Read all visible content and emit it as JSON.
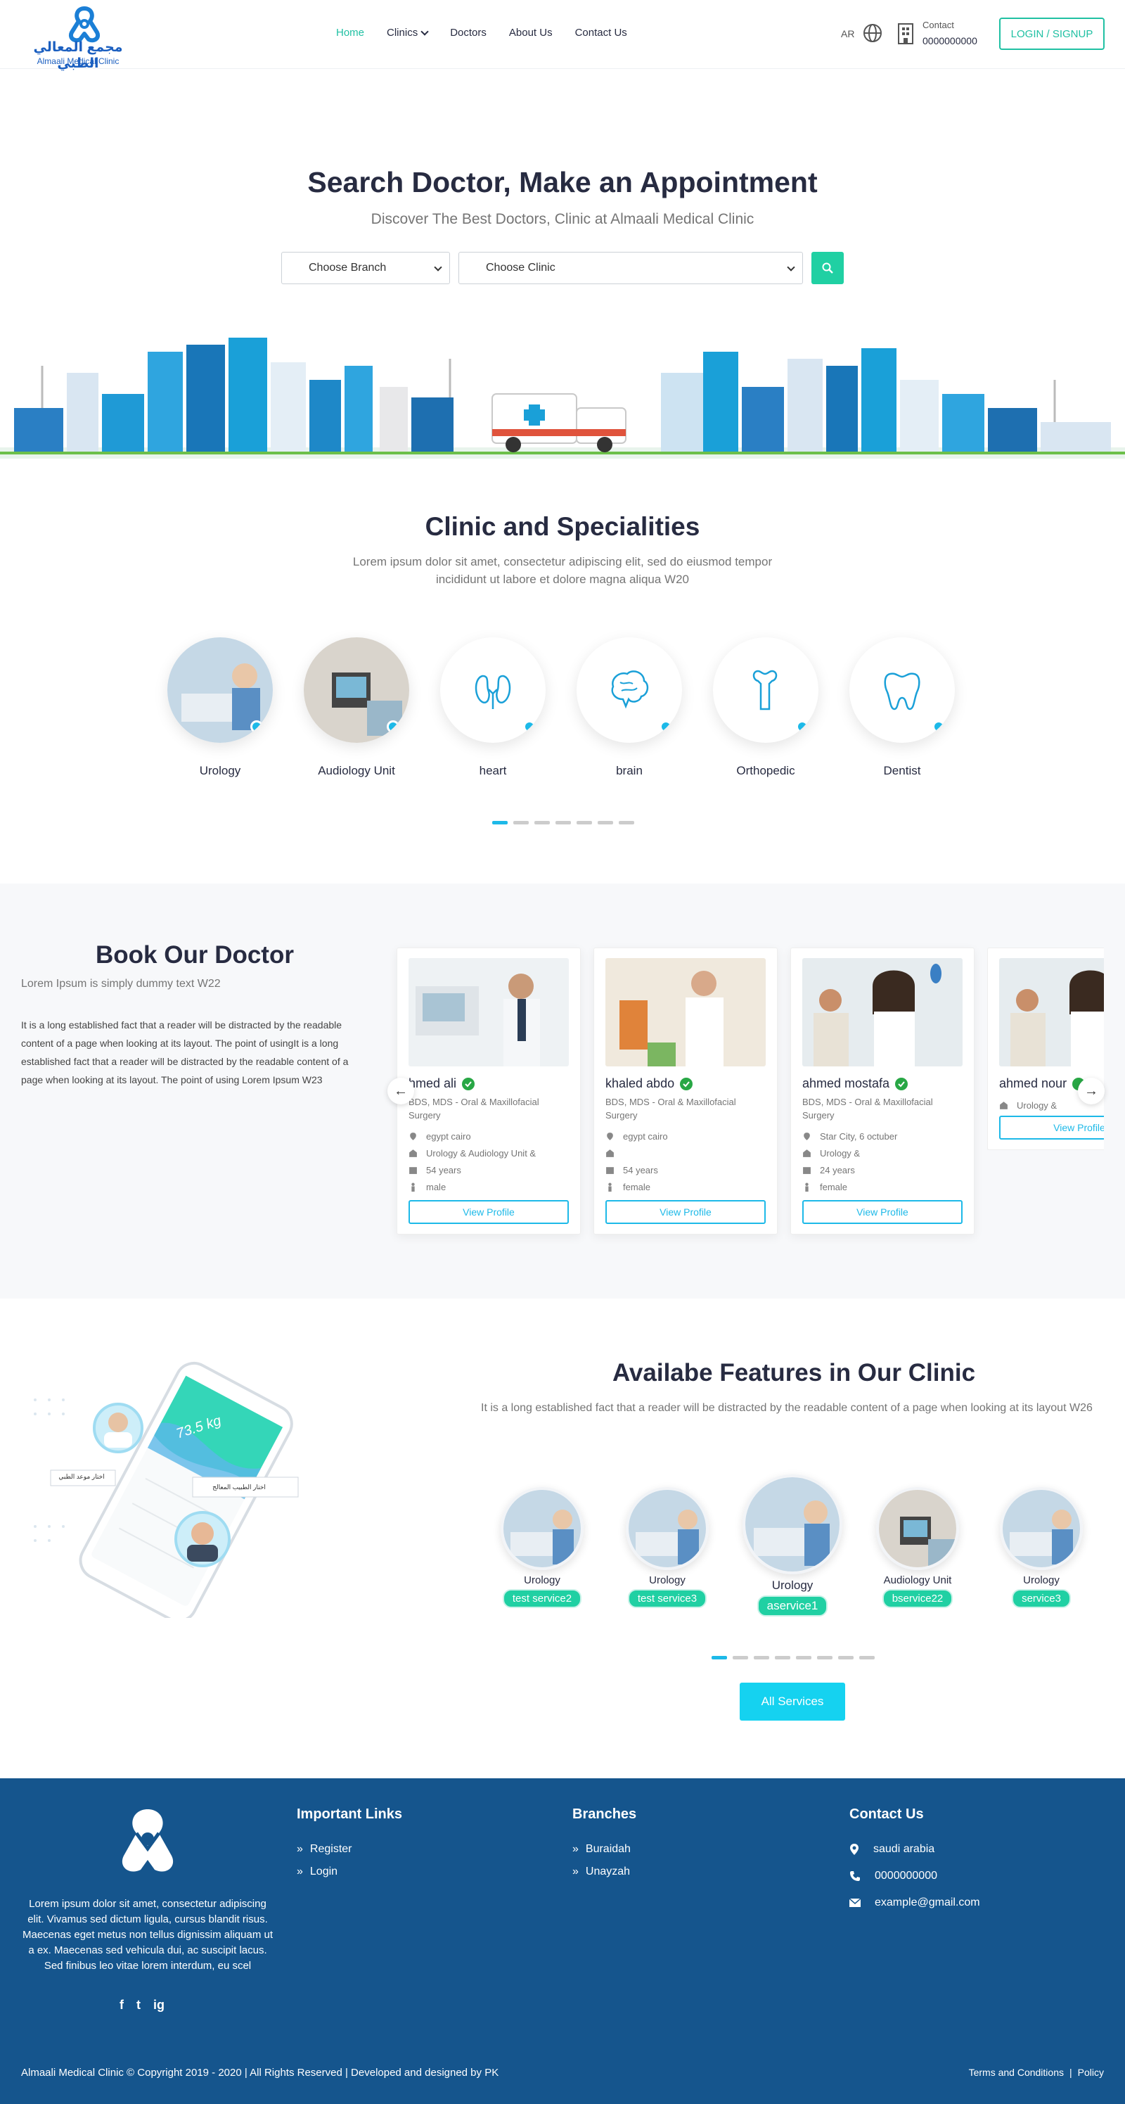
{
  "brand": {
    "name_ar": "مجمع المعالي الطبي",
    "name_en": "Almaali Medical Clinic"
  },
  "nav": {
    "items": [
      "Home",
      "Clinics",
      "Doctors",
      "About Us",
      "Contact Us"
    ],
    "lang": "AR",
    "contact_label": "Contact",
    "contact_number": "0000000000",
    "login_label": "LOGIN / SIGNUP"
  },
  "hero": {
    "title": "Search Doctor, Make an Appointment",
    "subtitle": "Discover The Best Doctors, Clinic at Almaali Medical Clinic",
    "branch_select": "Choose Branch",
    "clinic_select": "Choose Clinic"
  },
  "specialities": {
    "title": "Clinic and Specialities",
    "subtitle": "Lorem ipsum dolor sit amet, consectetur adipiscing elit, sed do eiusmod tempor incididunt ut labore et dolore magna aliqua W20",
    "items": [
      "Urology",
      "Audiology Unit",
      "heart",
      "brain",
      "Orthopedic",
      "Dentist"
    ]
  },
  "book": {
    "title": "Book Our Doctor",
    "subtitle": "Lorem Ipsum is simply dummy text W22",
    "text": "It is a long established fact that a reader will be distracted by the readable content of a page when looking at its layout. The point of usingIt is a long established fact that a reader will be distracted by the readable content of a page when looking at its layout. The point of using Lorem Ipsum W23",
    "view_label": "View Profile",
    "doctors": [
      {
        "name": "hmed ali",
        "degree": "BDS, MDS - Oral & Maxillofacial Surgery",
        "location": "egypt cairo",
        "clinic": "Urology & Audiology Unit &",
        "age": "54 years",
        "gender": "male"
      },
      {
        "name": "khaled abdo",
        "degree": "BDS, MDS - Oral & Maxillofacial Surgery",
        "location": "egypt cairo",
        "clinic": "",
        "age": "54 years",
        "gender": "female"
      },
      {
        "name": "ahmed mostafa",
        "degree": "BDS, MDS - Oral & Maxillofacial Surgery",
        "location": "Star City, 6 octuber",
        "clinic": "Urology &",
        "age": "24 years",
        "gender": "female"
      },
      {
        "name": "ahmed nour",
        "degree": "",
        "location": "",
        "clinic": "Urology &",
        "age": "",
        "gender": ""
      }
    ]
  },
  "features": {
    "title": "Availabe Features in Our Clinic",
    "text": "It is a long established fact that a reader will be distracted by the readable content of a page when looking at its layout W26",
    "items": [
      {
        "label": "Urology",
        "service": "test service2"
      },
      {
        "label": "Urology",
        "service": "test service3"
      },
      {
        "label": "Urology",
        "service": "aservice1"
      },
      {
        "label": "Audiology Unit",
        "service": "bservice22"
      },
      {
        "label": "Urology",
        "service": "service3"
      }
    ],
    "phone_tags": [
      "اختار موعد الطبي",
      "اختار الطبيب المعالج"
    ],
    "phone_weight": "73.5 kg",
    "all_label": "All Services"
  },
  "footer": {
    "about": "Lorem ipsum dolor sit amet, consectetur adipiscing elit. Vivamus sed dictum ligula, cursus blandit risus. Maecenas eget metus non tellus dignissim aliquam ut a ex. Maecenas sed vehicula dui, ac suscipit lacus. Sed finibus leo vitae lorem interdum, eu scel",
    "social": [
      "f",
      "t",
      "ig"
    ],
    "links_title": "Important Links",
    "links": [
      "Register",
      "Login"
    ],
    "branches_title": "Branches",
    "branches": [
      "Buraidah",
      "Unayzah"
    ],
    "contact_title": "Contact Us",
    "contact": [
      "saudi arabia",
      "0000000000",
      "example@gmail.com"
    ],
    "copyright": "Almaali Medical Clinic © Copyright 2019 - 2020 | All Rights Reserved | Developed and designed by PK",
    "terms": "Terms and Conditions",
    "policy": "Policy"
  },
  "colors": {
    "accent": "#20c0a3",
    "cyan": "#1db9e8",
    "footer": "#15558d",
    "dark": "#272b41"
  }
}
